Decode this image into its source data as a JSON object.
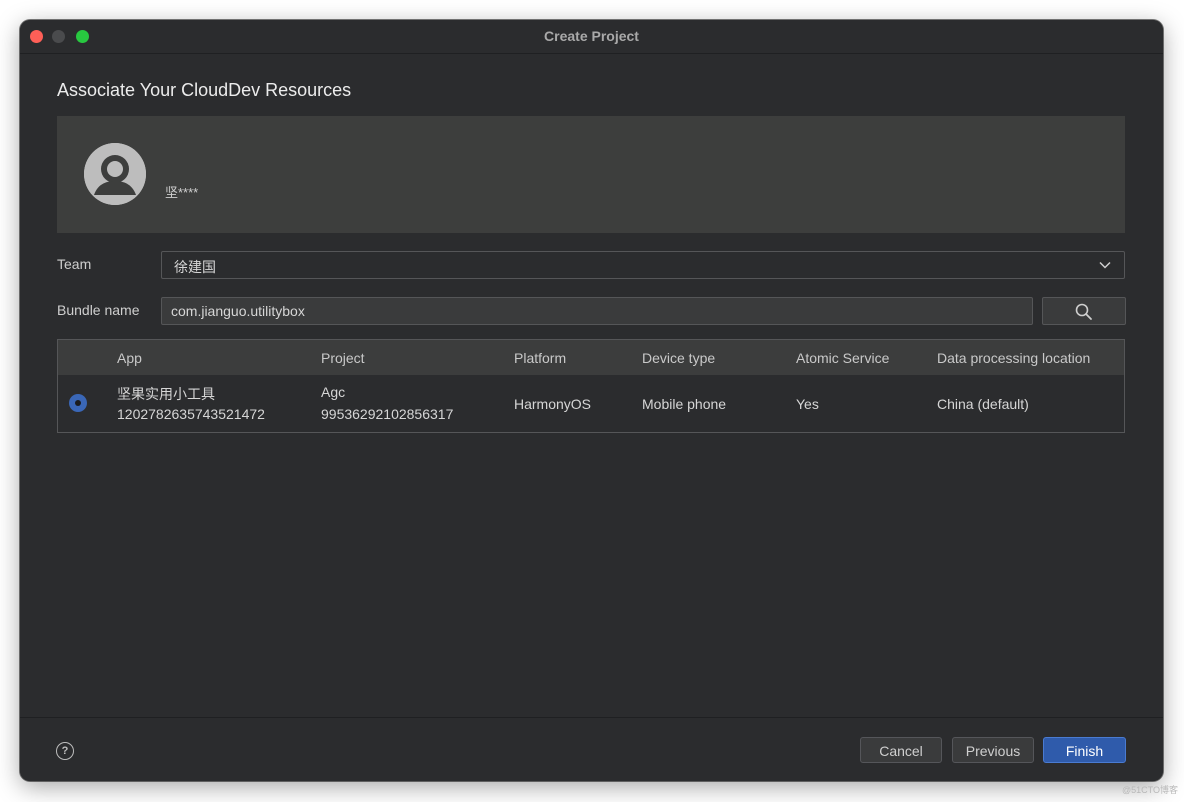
{
  "window": {
    "title": "Create Project"
  },
  "page": {
    "heading": "Associate Your CloudDev Resources"
  },
  "account": {
    "name": "坚****",
    "avatar_icon": "user-avatar-icon"
  },
  "form": {
    "team_label": "Team",
    "team_value": "徐建国",
    "bundle_label": "Bundle name",
    "bundle_value": "com.jianguo.utilitybox",
    "search_icon": "search-icon"
  },
  "table": {
    "headers": {
      "app": "App",
      "project": "Project",
      "platform": "Platform",
      "device_type": "Device type",
      "atomic_service": "Atomic Service",
      "data_location": "Data processing location"
    },
    "rows": [
      {
        "selected": true,
        "app_name": "坚果实用小工具",
        "app_id": "1202782635743521472",
        "project_name": "Agc",
        "project_id": "99536292102856317",
        "platform": "HarmonyOS",
        "device_type": "Mobile phone",
        "atomic_service": "Yes",
        "data_location": "China (default)"
      }
    ]
  },
  "footer": {
    "help_icon": "help-icon",
    "cancel_label": "Cancel",
    "previous_label": "Previous",
    "finish_label": "Finish"
  },
  "watermark": "@51CTO博客",
  "colors": {
    "window_bg": "#2b2c2e",
    "panel_bg": "#3d3e3d",
    "accent": "#2f5bab",
    "radio": "#3a67b7"
  }
}
